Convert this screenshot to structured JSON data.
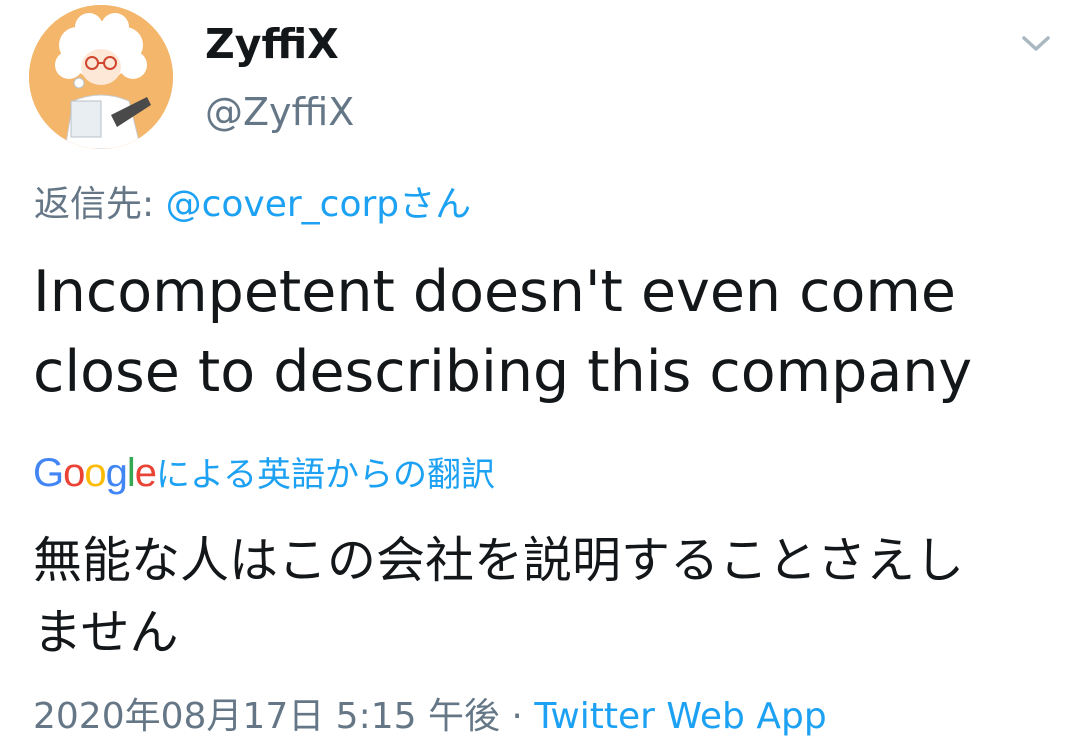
{
  "user": {
    "display_name": "ZyffiX",
    "handle": "@ZyffiX",
    "avatar_icon": "anime-character-avatar"
  },
  "menu_icon": "chevron-down-icon",
  "reply": {
    "prefix": "返信先: ",
    "mention": "@cover_corp",
    "suffix": "さん"
  },
  "tweet": {
    "text_lines": [
      "Incompetent doesn't even come",
      "close to describing this company"
    ]
  },
  "translation": {
    "provider_logo_letters": [
      "G",
      "o",
      "o",
      "g",
      "l",
      "e"
    ],
    "label": "による英語からの翻訳",
    "text_lines": [
      "無能な人はこの会社を説明することさえし",
      "ません"
    ]
  },
  "meta": {
    "timestamp": "2020年08月17日 5:15 午後",
    "separator": " · ",
    "source": "Twitter Web App"
  },
  "colors": {
    "text": "#14171a",
    "secondary": "#657786",
    "link": "#1da1f2"
  }
}
